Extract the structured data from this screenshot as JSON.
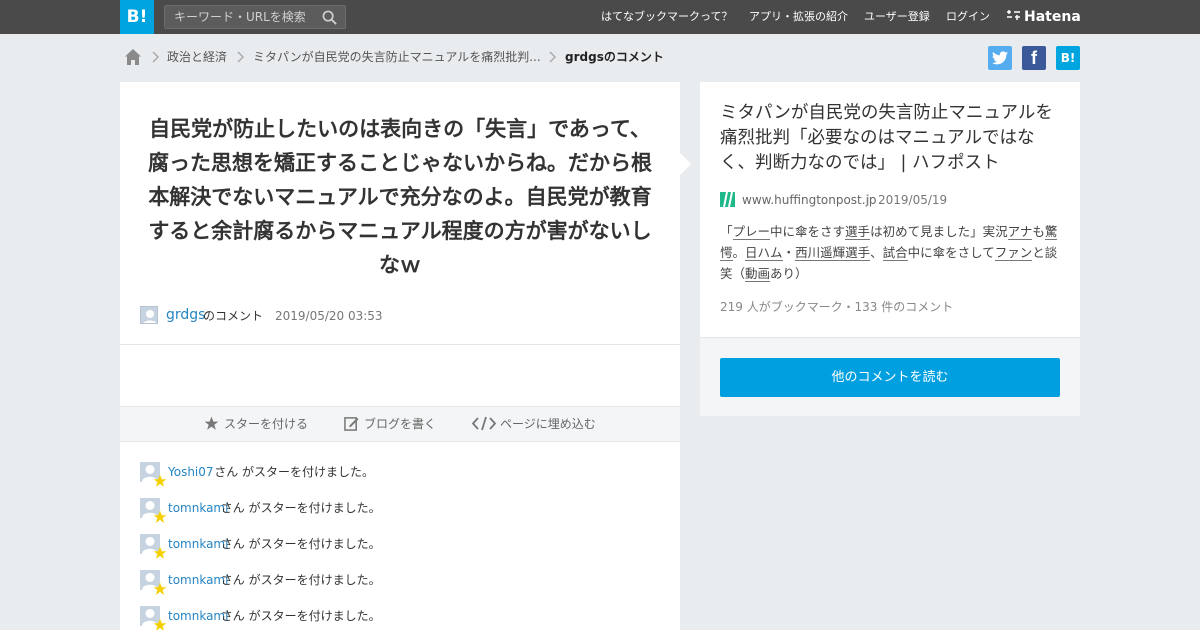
{
  "header": {
    "logo": "B!",
    "search_placeholder": "キーワード・URLを検索",
    "nav": [
      "はてなブックマークって？",
      "アプリ・拡張の紹介",
      "ユーザー登録",
      "ログイン"
    ],
    "brand": "Hatena"
  },
  "breadcrumb": {
    "items": [
      "政治と経済",
      "ミタパンが自民党の失言防止マニュアルを痛烈批判..."
    ],
    "current": "grdgsのコメント"
  },
  "share": {
    "twitter_color": "#55acee",
    "facebook_color": "#3b5998",
    "hatena_color": "#00a4de",
    "facebook_glyph": "f",
    "hatena_glyph": "B!"
  },
  "comment": {
    "text": "自民党が防止したいのは表向きの「失言」であって、腐った思想を矯正することじゃないからね。だから根本解決でないマニュアルで充分なのよ。自民党が教育すると余計腐るからマニュアル程度の方が害がないしなｗ",
    "user": "grdgs",
    "user_suffix": "のコメント",
    "timestamp": "2019/05/20 03:53"
  },
  "actions": {
    "star": "スターを付ける",
    "blog": "ブログを書く",
    "embed": "ページに埋め込む"
  },
  "star_rows": [
    {
      "user": "Yoshi07",
      "text": "さん がスターを付けました。"
    },
    {
      "user": "tomnkami",
      "text": "さん がスターを付けました。"
    },
    {
      "user": "tomnkami",
      "text": "さん がスターを付けました。"
    },
    {
      "user": "tomnkami",
      "text": "さん がスターを付けました。"
    },
    {
      "user": "tomnkami",
      "text": "さん がスターを付けました。"
    }
  ],
  "entry": {
    "title": "ミタパンが自民党の失言防止マニュアルを痛烈批判「必要なのはマニュアルではなく、判断力なのでは」 | ハフポスト",
    "domain": "www.huffingtonpost.jp",
    "date": "2019/05/19",
    "description_parts": [
      {
        "t": "「",
        "u": false
      },
      {
        "t": "プレー",
        "u": true
      },
      {
        "t": "中に傘をさす",
        "u": false
      },
      {
        "t": "選手",
        "u": true
      },
      {
        "t": "は初めて見ました」実況",
        "u": false
      },
      {
        "t": "アナ",
        "u": true
      },
      {
        "t": "も",
        "u": false
      },
      {
        "t": "驚愕",
        "u": true
      },
      {
        "t": "。",
        "u": false
      },
      {
        "t": "日ハム",
        "u": true
      },
      {
        "t": "・",
        "u": false
      },
      {
        "t": "西川遥輝",
        "u": true
      },
      {
        "t": "選手",
        "u": true
      },
      {
        "t": "、",
        "u": false
      },
      {
        "t": "試合",
        "u": true
      },
      {
        "t": "中に傘をさして",
        "u": false
      },
      {
        "t": "ファン",
        "u": true
      },
      {
        "t": "と談笑（",
        "u": false
      },
      {
        "t": "動画",
        "u": true
      },
      {
        "t": "あり）",
        "u": false
      }
    ],
    "counts": "219 人がブックマーク・133 件のコメント",
    "read_more": "他のコメントを読む"
  }
}
